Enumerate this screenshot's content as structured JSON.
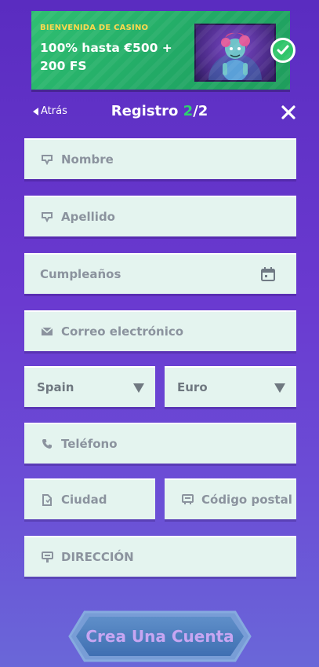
{
  "banner": {
    "eyebrow": "BIENVENIDA DE CASINO",
    "offer": "100% hasta €500 + 200 FS",
    "character_icon": "zombie-girl-character",
    "badge_icon": "check-icon"
  },
  "header": {
    "back_label": "Atrás",
    "title_prefix": "Registro ",
    "title_step": "2",
    "title_suffix": "/2",
    "close_icon": "close-icon"
  },
  "form": {
    "first_name": {
      "placeholder": "Nombre",
      "icon": "person-icon"
    },
    "last_name": {
      "placeholder": "Apellido",
      "icon": "person-icon"
    },
    "birthday": {
      "placeholder": "Cumpleaños",
      "icon": "calendar-icon"
    },
    "email": {
      "placeholder": "Correo electrónico",
      "icon": "mail-icon"
    },
    "country": {
      "value": "Spain",
      "icon": "caret-down-icon"
    },
    "currency": {
      "value": "Euro",
      "icon": "caret-down-icon"
    },
    "phone": {
      "placeholder": "Teléfono",
      "icon": "phone-icon"
    },
    "city": {
      "placeholder": "Ciudad",
      "icon": "city-icon"
    },
    "postal_code": {
      "placeholder": "Código postal",
      "icon": "postal-icon"
    },
    "address": {
      "placeholder": "DIRECCIÓN",
      "icon": "address-icon"
    }
  },
  "cta": {
    "label": "Crea Una Cuenta"
  },
  "colors": {
    "accent_green": "#2fd26f",
    "field_bg": "#e4f4ef",
    "placeholder": "#8b939e",
    "cta_text": "#c7a6f2"
  }
}
